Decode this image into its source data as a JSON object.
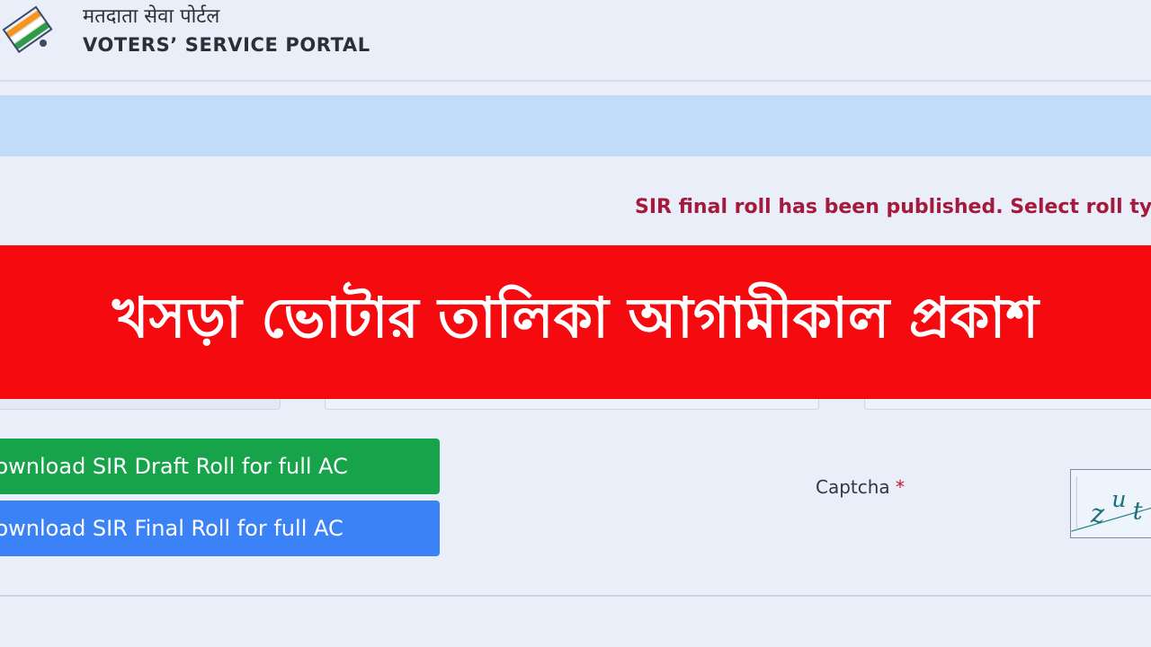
{
  "header": {
    "title_hindi": "मतदाता सेवा पोर्टल",
    "title_english": "VOTERS’ SERVICE PORTAL",
    "logo_icon": "eci-ballot-logo-icon"
  },
  "notice": {
    "text": "SIR final roll has been published. Select roll type \""
  },
  "banner": {
    "text": "খসড়া ভোটার তালিকা আগামীকাল প্রকাশ",
    "color": "#f40a0f"
  },
  "buttons": {
    "draft_label": "Download SIR Draft Roll for full AC",
    "final_label": "Download SIR Final Roll for full AC",
    "draft_color": "#17a34a",
    "final_color": "#3b82f6"
  },
  "captcha": {
    "label": "Captcha",
    "required_mark": "*",
    "image_text": "zut"
  }
}
